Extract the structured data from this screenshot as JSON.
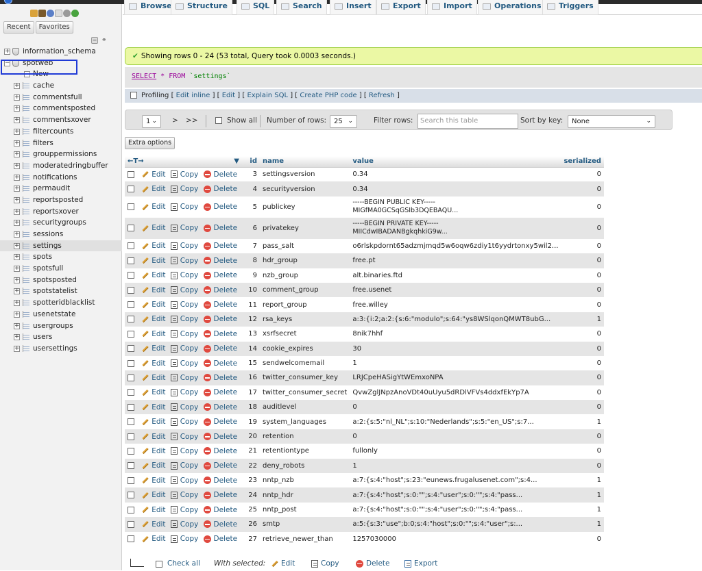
{
  "sidebar": {
    "recent_label": "Recent",
    "favorites_label": "Favorites",
    "databases": [
      {
        "name": "information_schema"
      },
      {
        "name": "spotweb"
      }
    ],
    "new_label": "New",
    "tables": [
      "cache",
      "commentsfull",
      "commentsposted",
      "commentsxover",
      "filtercounts",
      "filters",
      "grouppermissions",
      "moderatedringbuffer",
      "notifications",
      "permaudit",
      "reportsposted",
      "reportsxover",
      "securitygroups",
      "sessions",
      "settings",
      "spots",
      "spotsfull",
      "spotsposted",
      "spotstatelist",
      "spotteridblacklist",
      "usenetstate",
      "usergroups",
      "users",
      "usersettings"
    ],
    "selected_table": "settings"
  },
  "tabs": [
    {
      "label": "Browse"
    },
    {
      "label": "Structure"
    },
    {
      "label": "SQL"
    },
    {
      "label": "Search"
    },
    {
      "label": "Insert"
    },
    {
      "label": "Export"
    },
    {
      "label": "Import"
    },
    {
      "label": "Operations"
    },
    {
      "label": "Triggers"
    }
  ],
  "result": {
    "message": "Showing rows 0 - 24 (53 total, Query took 0.0003 seconds.)"
  },
  "sql": {
    "select": "SELECT",
    "star": "*",
    "from": "FROM",
    "table": "`settings`"
  },
  "profiling": {
    "label": "Profiling",
    "links": [
      "Edit inline",
      "Edit",
      "Explain SQL",
      "Create PHP code",
      "Refresh"
    ]
  },
  "nav": {
    "page_value": "1",
    "next": ">",
    "last": ">>",
    "show_all": "Show all",
    "rows_label": "Number of rows:",
    "rows_value": "25",
    "filter_label": "Filter rows:",
    "filter_placeholder": "Search this table",
    "sort_label": "Sort by key:",
    "sort_value": "None"
  },
  "extra_options": "Extra options",
  "table": {
    "headers": {
      "arrows": "←T→",
      "id": "id",
      "name": "name",
      "value": "value",
      "serialized": "serialized"
    },
    "actions": {
      "edit": "Edit",
      "copy": "Copy",
      "delete": "Delete"
    },
    "rows": [
      {
        "id": "3",
        "name": "settingsversion",
        "value": "0.34",
        "serialized": "0"
      },
      {
        "id": "4",
        "name": "securityversion",
        "value": "0.34",
        "serialized": "0"
      },
      {
        "id": "5",
        "name": "publickey",
        "value": "-----BEGIN PUBLIC KEY-----",
        "value2": "MIGfMA0GCSqGSIb3DQEBAQU...",
        "serialized": "0"
      },
      {
        "id": "6",
        "name": "privatekey",
        "value": "-----BEGIN PRIVATE KEY-----",
        "value2": "MIICdwIBADANBgkqhkiG9w...",
        "serialized": "0"
      },
      {
        "id": "7",
        "name": "pass_salt",
        "value": "o6rlskpdornt65adzmjmqd5w6oqw6zdiy1t6yydrtonxy5wil2...",
        "serialized": "0"
      },
      {
        "id": "8",
        "name": "hdr_group",
        "value": "free.pt",
        "serialized": "0"
      },
      {
        "id": "9",
        "name": "nzb_group",
        "value": "alt.binaries.ftd",
        "serialized": "0"
      },
      {
        "id": "10",
        "name": "comment_group",
        "value": "free.usenet",
        "serialized": "0"
      },
      {
        "id": "11",
        "name": "report_group",
        "value": "free.willey",
        "serialized": "0"
      },
      {
        "id": "12",
        "name": "rsa_keys",
        "value": "a:3:{i:2;a:2:{s:6:\"modulo\";s:64:\"ys8WSlqonQMWT8ubG...",
        "serialized": "1"
      },
      {
        "id": "13",
        "name": "xsrfsecret",
        "value": "8nik7hhf",
        "serialized": "0"
      },
      {
        "id": "14",
        "name": "cookie_expires",
        "value": "30",
        "serialized": "0"
      },
      {
        "id": "15",
        "name": "sendwelcomemail",
        "value": "1",
        "serialized": "0"
      },
      {
        "id": "16",
        "name": "twitter_consumer_key",
        "value": "LRJCpeHASigYtWEmxoNPA",
        "serialized": "0"
      },
      {
        "id": "17",
        "name": "twitter_consumer_secret",
        "value": "QvwZglJNpzAnoVDt40uUyu5dRDlVFVs4ddxfEkYp7A",
        "serialized": "0"
      },
      {
        "id": "18",
        "name": "auditlevel",
        "value": "0",
        "serialized": "0"
      },
      {
        "id": "19",
        "name": "system_languages",
        "value": "a:2:{s:5:\"nl_NL\";s:10:\"Nederlands\";s:5:\"en_US\";s:7...",
        "serialized": "1"
      },
      {
        "id": "20",
        "name": "retention",
        "value": "0",
        "serialized": "0"
      },
      {
        "id": "21",
        "name": "retentiontype",
        "value": "fullonly",
        "serialized": "0"
      },
      {
        "id": "22",
        "name": "deny_robots",
        "value": "1",
        "serialized": "0"
      },
      {
        "id": "23",
        "name": "nntp_nzb",
        "value": "a:7:{s:4:\"host\";s:23:\"eunews.frugalusenet.com\";s:4...",
        "serialized": "1"
      },
      {
        "id": "24",
        "name": "nntp_hdr",
        "value": "a:7:{s:4:\"host\";s:0:\"\";s:4:\"user\";s:0:\"\";s:4:\"pass...",
        "serialized": "1"
      },
      {
        "id": "25",
        "name": "nntp_post",
        "value": "a:7:{s:4:\"host\";s:0:\"\";s:4:\"user\";s:0:\"\";s:4:\"pass...",
        "serialized": "1"
      },
      {
        "id": "26",
        "name": "smtp",
        "value": "a:5:{s:3:\"use\";b:0;s:4:\"host\";s:0:\"\";s:4:\"user\";s:...",
        "serialized": "1"
      },
      {
        "id": "27",
        "name": "retrieve_newer_than",
        "value": "1257030000",
        "serialized": "0"
      }
    ]
  },
  "bottom": {
    "check_all": "Check all",
    "with_selected": "With selected:",
    "edit": "Edit",
    "copy": "Copy",
    "delete": "Delete",
    "export": "Export"
  }
}
